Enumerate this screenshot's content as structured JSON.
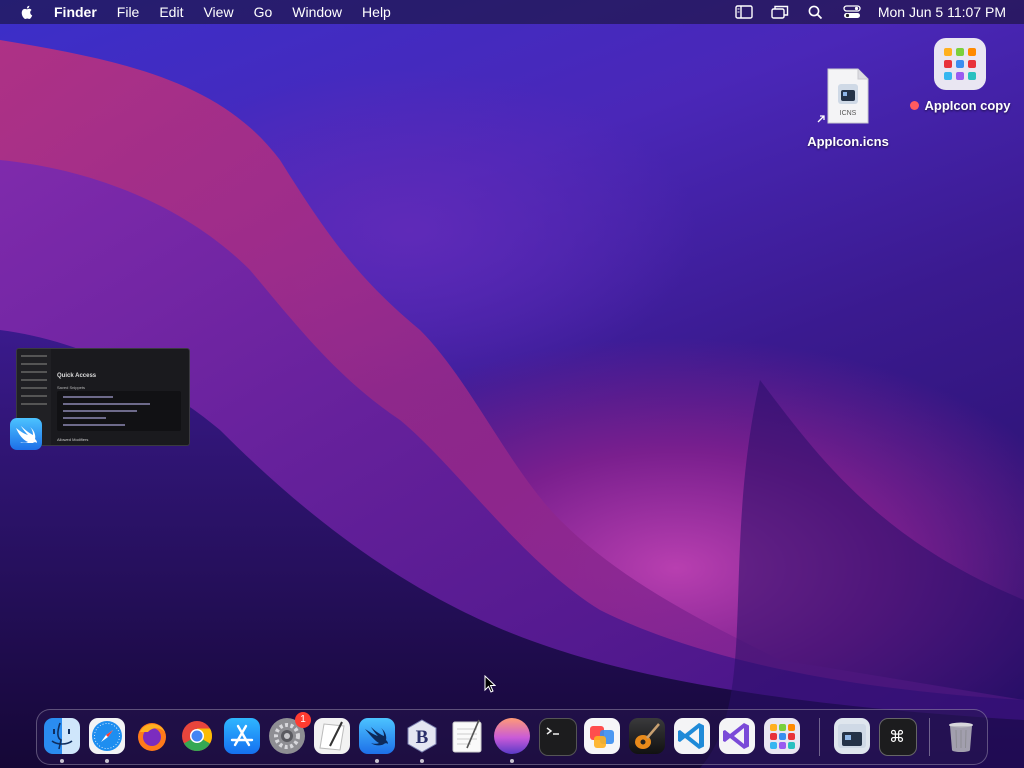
{
  "menubar": {
    "app_name": "Finder",
    "menus": [
      "File",
      "Edit",
      "View",
      "Go",
      "Window",
      "Help"
    ],
    "clock": "Mon Jun 5  11:07 PM"
  },
  "desktop": {
    "icns_file": {
      "label": "AppIcon.icns",
      "doc_text": "ICNS"
    },
    "appicon_copy": {
      "label": "AppIcon copy",
      "tag_color": "#ff5a5f"
    }
  },
  "preview": {
    "title": "Quick Access",
    "subtitle": "Saved Snippets",
    "footer": "Allowed Modifiers"
  },
  "dock": {
    "apps": [
      {
        "name": "Finder",
        "running": true
      },
      {
        "name": "Safari",
        "running": true
      },
      {
        "name": "Firefox",
        "running": false
      },
      {
        "name": "Google Chrome",
        "running": false
      },
      {
        "name": "App Store",
        "running": false
      },
      {
        "name": "System Settings",
        "running": false,
        "badge": "1"
      },
      {
        "name": "Script Editor",
        "running": false
      },
      {
        "name": "Swift Quick Access",
        "running": true
      },
      {
        "name": "BBEdit",
        "running": true
      },
      {
        "name": "TextEdit",
        "running": false
      },
      {
        "name": "Wallpaper",
        "running": true
      },
      {
        "name": "Terminal",
        "running": false
      },
      {
        "name": "Icon Composer",
        "running": false
      },
      {
        "name": "GarageBand",
        "running": false
      },
      {
        "name": "Visual Studio Code",
        "running": false
      },
      {
        "name": "Visual Studio",
        "running": false
      },
      {
        "name": "AppIcon Grid",
        "running": false
      }
    ],
    "others": [
      {
        "name": "AppIcon.icns"
      },
      {
        "name": "Keyboard Shortcuts"
      },
      {
        "name": "Trash"
      }
    ]
  },
  "colors": {
    "badge": "#ff3b30",
    "tag_red": "#ff5a5f"
  }
}
